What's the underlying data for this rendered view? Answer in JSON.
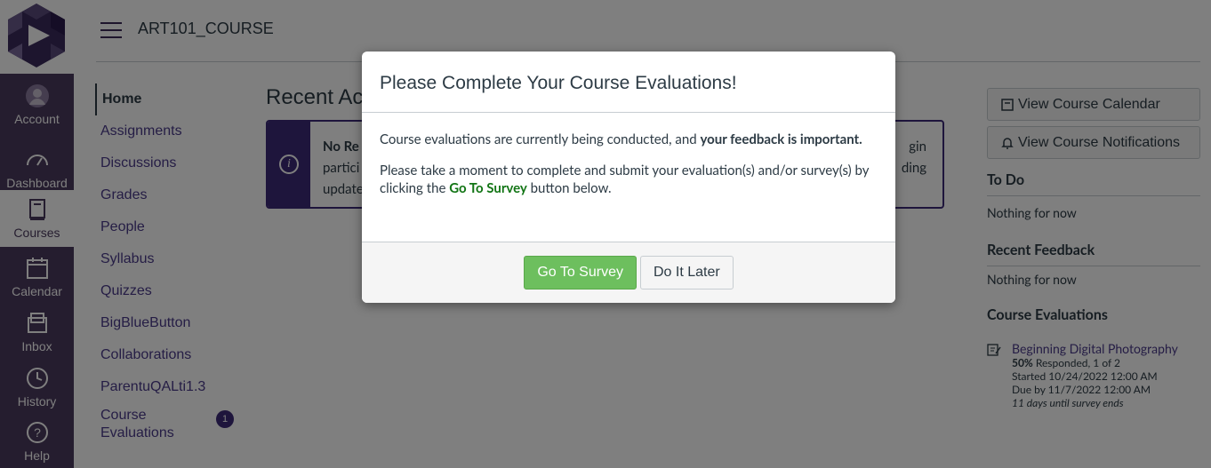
{
  "colors": {
    "brand": "#4a3a5e",
    "accent": "#3c2a78",
    "green": "#127515",
    "button_green": "#6dbf5e"
  },
  "global_nav": {
    "items": [
      {
        "label": "Account",
        "icon": "user-icon"
      },
      {
        "label": "Dashboard",
        "icon": "dashboard-icon"
      },
      {
        "label": "Courses",
        "icon": "book-icon",
        "active": true
      },
      {
        "label": "Calendar",
        "icon": "calendar-icon"
      },
      {
        "label": "Inbox",
        "icon": "inbox-icon"
      },
      {
        "label": "History",
        "icon": "clock-icon"
      },
      {
        "label": "Help",
        "icon": "help-icon"
      }
    ]
  },
  "header": {
    "course_title": "ART101_COURSE"
  },
  "course_nav": {
    "items": [
      {
        "label": "Home"
      },
      {
        "label": "Assignments"
      },
      {
        "label": "Discussions"
      },
      {
        "label": "Grades"
      },
      {
        "label": "People"
      },
      {
        "label": "Syllabus"
      },
      {
        "label": "Quizzes"
      },
      {
        "label": "BigBlueButton"
      },
      {
        "label": "Collaborations"
      },
      {
        "label": "ParentuQALti1.3"
      },
      {
        "label": "Course Evaluations",
        "badge": "1"
      }
    ]
  },
  "main": {
    "recent_title": "Recent Ac",
    "notice": {
      "title": "No Re",
      "line1": "partici",
      "line2": "update",
      "right1": "gin",
      "right2": "ding"
    }
  },
  "sidebar": {
    "calendar_button": "View Course Calendar",
    "notifications_button": "View Course Notifications",
    "todo_title": "To Do",
    "todo_empty": "Nothing for now",
    "feedback_title": "Recent Feedback",
    "feedback_empty": "Nothing for now",
    "evals_title": "Course Evaluations",
    "eval": {
      "name": "Beginning Digital Photography",
      "percent": "50%",
      "responded": " Responded, 1 of 2",
      "started": "Started 10/24/2022 12:00 AM",
      "due": "Due by 11/7/2022 12:00 AM",
      "remaining": "11 days until survey ends"
    }
  },
  "modal": {
    "title": "Please Complete Your Course Evaluations!",
    "p1_a": "Course evaluations are currently being conducted, and ",
    "p1_b": "your feedback is important.",
    "p2_a": "Please take a moment to complete and submit your evaluation(s) and/or survey(s) by clicking the ",
    "p2_link": "Go To Survey",
    "p2_b": " button below.",
    "go_button": "Go To Survey",
    "later_button": "Do It Later"
  }
}
